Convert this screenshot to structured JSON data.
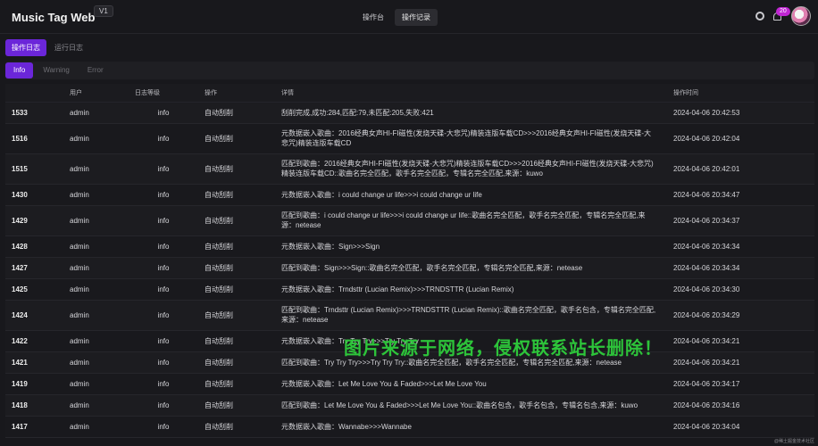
{
  "header": {
    "title": "Music Tag Web",
    "version": "V1",
    "nav": [
      {
        "label": "操作台",
        "active": false
      },
      {
        "label": "操作记录",
        "active": true
      }
    ],
    "badge": "20"
  },
  "log_tabs": [
    {
      "label": "操作日志",
      "active": true
    },
    {
      "label": "运行日志",
      "active": false
    }
  ],
  "level_tabs": [
    {
      "label": "Info",
      "active": true
    },
    {
      "label": "Warning",
      "active": false
    },
    {
      "label": "Error",
      "active": false
    }
  ],
  "table": {
    "columns": [
      "",
      "用户",
      "日志等级",
      "操作",
      "详情",
      "操作时间"
    ],
    "rows": [
      {
        "id": "1533",
        "user": "admin",
        "level": "info",
        "action": "自动刮削",
        "detail": "刮削完成,成功:284,匹配:79,未匹配:205,失败:421",
        "time": "2024-04-06 20:42:53"
      },
      {
        "id": "1516",
        "user": "admin",
        "level": "info",
        "action": "自动刮削",
        "detail": "元数据嵌入歌曲：2016经典女声HI-FI磁性(发烧天碟-大悲咒)精装连版车载CD>>>2016经典女声HI-FI磁性(发烧天碟-大悲咒)精装连版车载CD",
        "time": "2024-04-06 20:42:04"
      },
      {
        "id": "1515",
        "user": "admin",
        "level": "info",
        "action": "自动刮削",
        "detail": "匹配到歌曲：2016经典女声HI-FI磁性(发烧天碟-大悲咒)精装连版车载CD>>>2016经典女声HI-FI磁性(发烧天碟-大悲咒)精装连版车载CD::歌曲名完全匹配，歌手名完全匹配，专辑名完全匹配,来源：kuwo",
        "time": "2024-04-06 20:42:01"
      },
      {
        "id": "1430",
        "user": "admin",
        "level": "info",
        "action": "自动刮削",
        "detail": "元数据嵌入歌曲：i could change ur life>>>i could change ur life",
        "time": "2024-04-06 20:34:47"
      },
      {
        "id": "1429",
        "user": "admin",
        "level": "info",
        "action": "自动刮削",
        "detail": "匹配到歌曲：i could change ur life>>>i could change ur life::歌曲名完全匹配，歌手名完全匹配，专辑名完全匹配,来源：netease",
        "time": "2024-04-06 20:34:37"
      },
      {
        "id": "1428",
        "user": "admin",
        "level": "info",
        "action": "自动刮削",
        "detail": "元数据嵌入歌曲：Sign>>>Sign",
        "time": "2024-04-06 20:34:34"
      },
      {
        "id": "1427",
        "user": "admin",
        "level": "info",
        "action": "自动刮削",
        "detail": "匹配到歌曲：Sign>>>Sign::歌曲名完全匹配，歌手名完全匹配，专辑名完全匹配,来源：netease",
        "time": "2024-04-06 20:34:34"
      },
      {
        "id": "1425",
        "user": "admin",
        "level": "info",
        "action": "自动刮削",
        "detail": "元数据嵌入歌曲：Trndsttr (Lucian Remix)>>>TRNDSTTR (Lucian Remix)",
        "time": "2024-04-06 20:34:30"
      },
      {
        "id": "1424",
        "user": "admin",
        "level": "info",
        "action": "自动刮削",
        "detail": "匹配到歌曲：Trndsttr (Lucian Remix)>>>TRNDSTTR (Lucian Remix)::歌曲名完全匹配，歌手名包含，专辑名完全匹配,来源：netease",
        "time": "2024-04-06 20:34:29"
      },
      {
        "id": "1422",
        "user": "admin",
        "level": "info",
        "action": "自动刮削",
        "detail": "元数据嵌入歌曲：Try Try Try>>>Try Try Try",
        "time": "2024-04-06 20:34:21"
      },
      {
        "id": "1421",
        "user": "admin",
        "level": "info",
        "action": "自动刮削",
        "detail": "匹配到歌曲：Try Try Try>>>Try Try Try::歌曲名完全匹配，歌手名完全匹配，专辑名完全匹配,来源：netease",
        "time": "2024-04-06 20:34:21"
      },
      {
        "id": "1419",
        "user": "admin",
        "level": "info",
        "action": "自动刮削",
        "detail": "元数据嵌入歌曲：Let Me Love You & Faded>>>Let Me Love You",
        "time": "2024-04-06 20:34:17"
      },
      {
        "id": "1418",
        "user": "admin",
        "level": "info",
        "action": "自动刮削",
        "detail": "匹配到歌曲：Let Me Love You & Faded>>>Let Me Love You::歌曲名包含，歌手名包含，专辑名包含,来源：kuwo",
        "time": "2024-04-06 20:34:16"
      },
      {
        "id": "1417",
        "user": "admin",
        "level": "info",
        "action": "自动刮削",
        "detail": "元数据嵌入歌曲：Wannabe>>>Wannabe",
        "time": "2024-04-06 20:34:04"
      }
    ]
  },
  "watermark": "图片来源于网络，侵权联系站长删除！",
  "footer_mark": "@稀土掘金技术社区",
  "colors": {
    "accent": "#6b26d9",
    "badge": "#c026d3",
    "watermark": "#2dc43a"
  }
}
